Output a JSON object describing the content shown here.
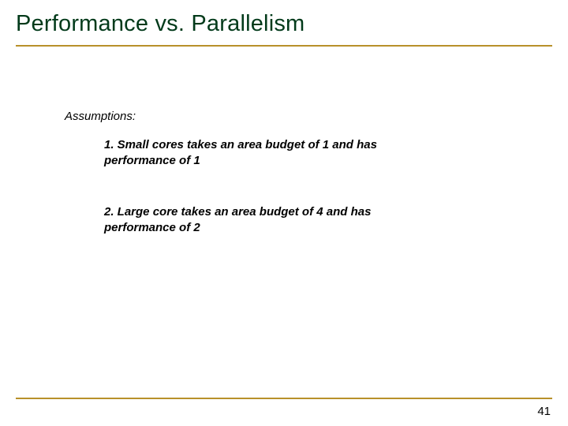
{
  "slide": {
    "title": "Performance vs. Parallelism",
    "assumptions_label": "Assumptions:",
    "assumptions": {
      "item1": "1. Small cores takes an area budget of 1 and has performance  of 1",
      "item2": "2. Large core takes an area budget of 4 and has performance of 2"
    },
    "page_number": "41"
  }
}
